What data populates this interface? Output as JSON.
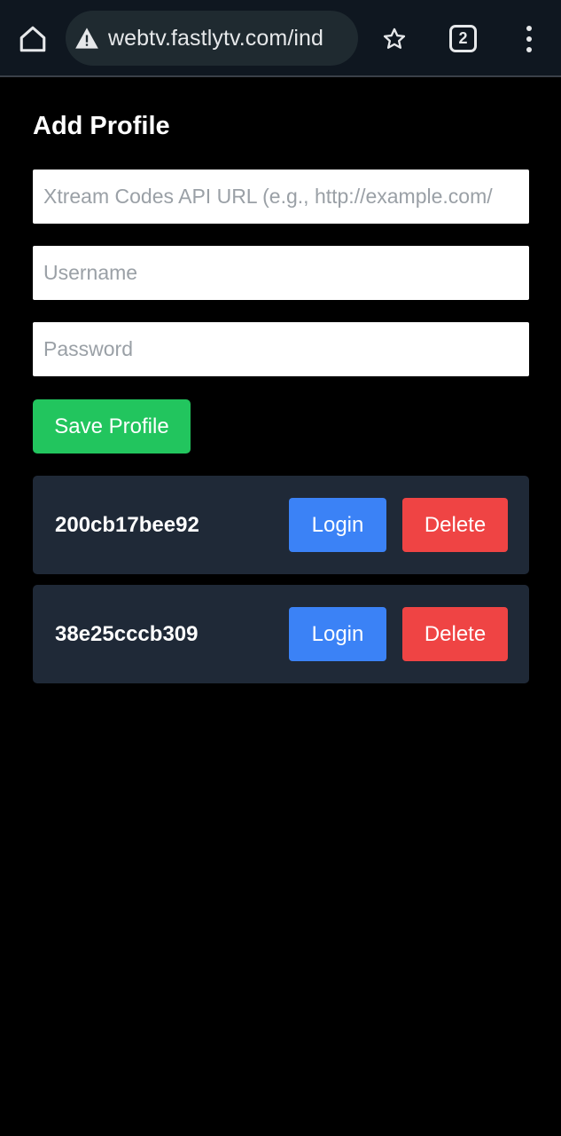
{
  "browser": {
    "url": "webtv.fastlytv.com/ind",
    "tab_count": "2",
    "icons": [
      "home-icon",
      "warning-icon",
      "star-icon",
      "tab-switcher-icon",
      "more-vert-icon"
    ]
  },
  "form": {
    "title": "Add Profile",
    "url_placeholder": "Xtream Codes API URL (e.g., http://example.com/",
    "username_placeholder": "Username",
    "password_placeholder": "Password",
    "save_label": "Save Profile"
  },
  "profiles": [
    {
      "name": "200cb17bee92",
      "login_label": "Login",
      "delete_label": "Delete"
    },
    {
      "name": "38e25cccb309",
      "login_label": "Login",
      "delete_label": "Delete"
    }
  ],
  "colors": {
    "save": "#22c55e",
    "login": "#3b82f6",
    "delete": "#ef4444",
    "card": "#1f2937",
    "background": "#000000"
  }
}
